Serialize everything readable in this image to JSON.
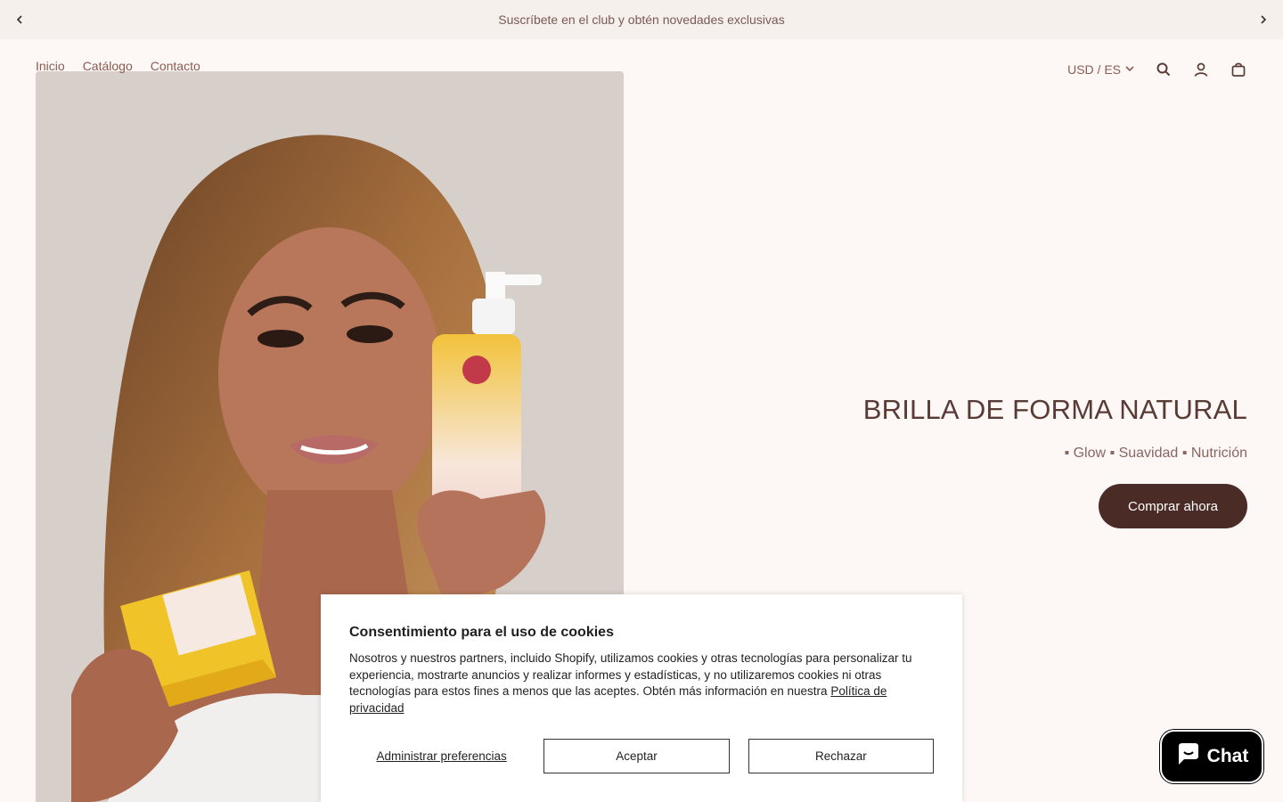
{
  "announcement": {
    "text": "Suscríbete en el club y obtén novedades exclusivas"
  },
  "nav": {
    "items": [
      "Inicio",
      "Catálogo",
      "Contacto"
    ]
  },
  "header": {
    "locale": "USD / ES",
    "icons": [
      "search-icon",
      "account-icon",
      "cart-icon"
    ]
  },
  "hero": {
    "title": "BRILLA DE FORMA NATURAL",
    "subtitle": "▪ Glow ▪ Suavidad ▪ Nutrición",
    "button": "Comprar ahora"
  },
  "cookie": {
    "title": "Consentimiento para el uso de cookies",
    "body": "Nosotros y nuestros partners, incluido Shopify, utilizamos cookies y otras tecnologías para personalizar tu experiencia, mostrarte anuncios y realizar informes y estadísticas, y no utilizaremos cookies ni otras tecnologías para estos fines a menos que las aceptes. Obtén más información en nuestra",
    "link": "Política de privacidad",
    "manage": "Administrar preferencias",
    "accept": "Aceptar",
    "reject": "Rechazar"
  },
  "chat": {
    "label": "Chat"
  },
  "colors": {
    "background": "#fdf8f6",
    "announcement_bg": "#f6f0ec",
    "accent": "#4a2b26",
    "nav_text": "#8a5b52"
  }
}
